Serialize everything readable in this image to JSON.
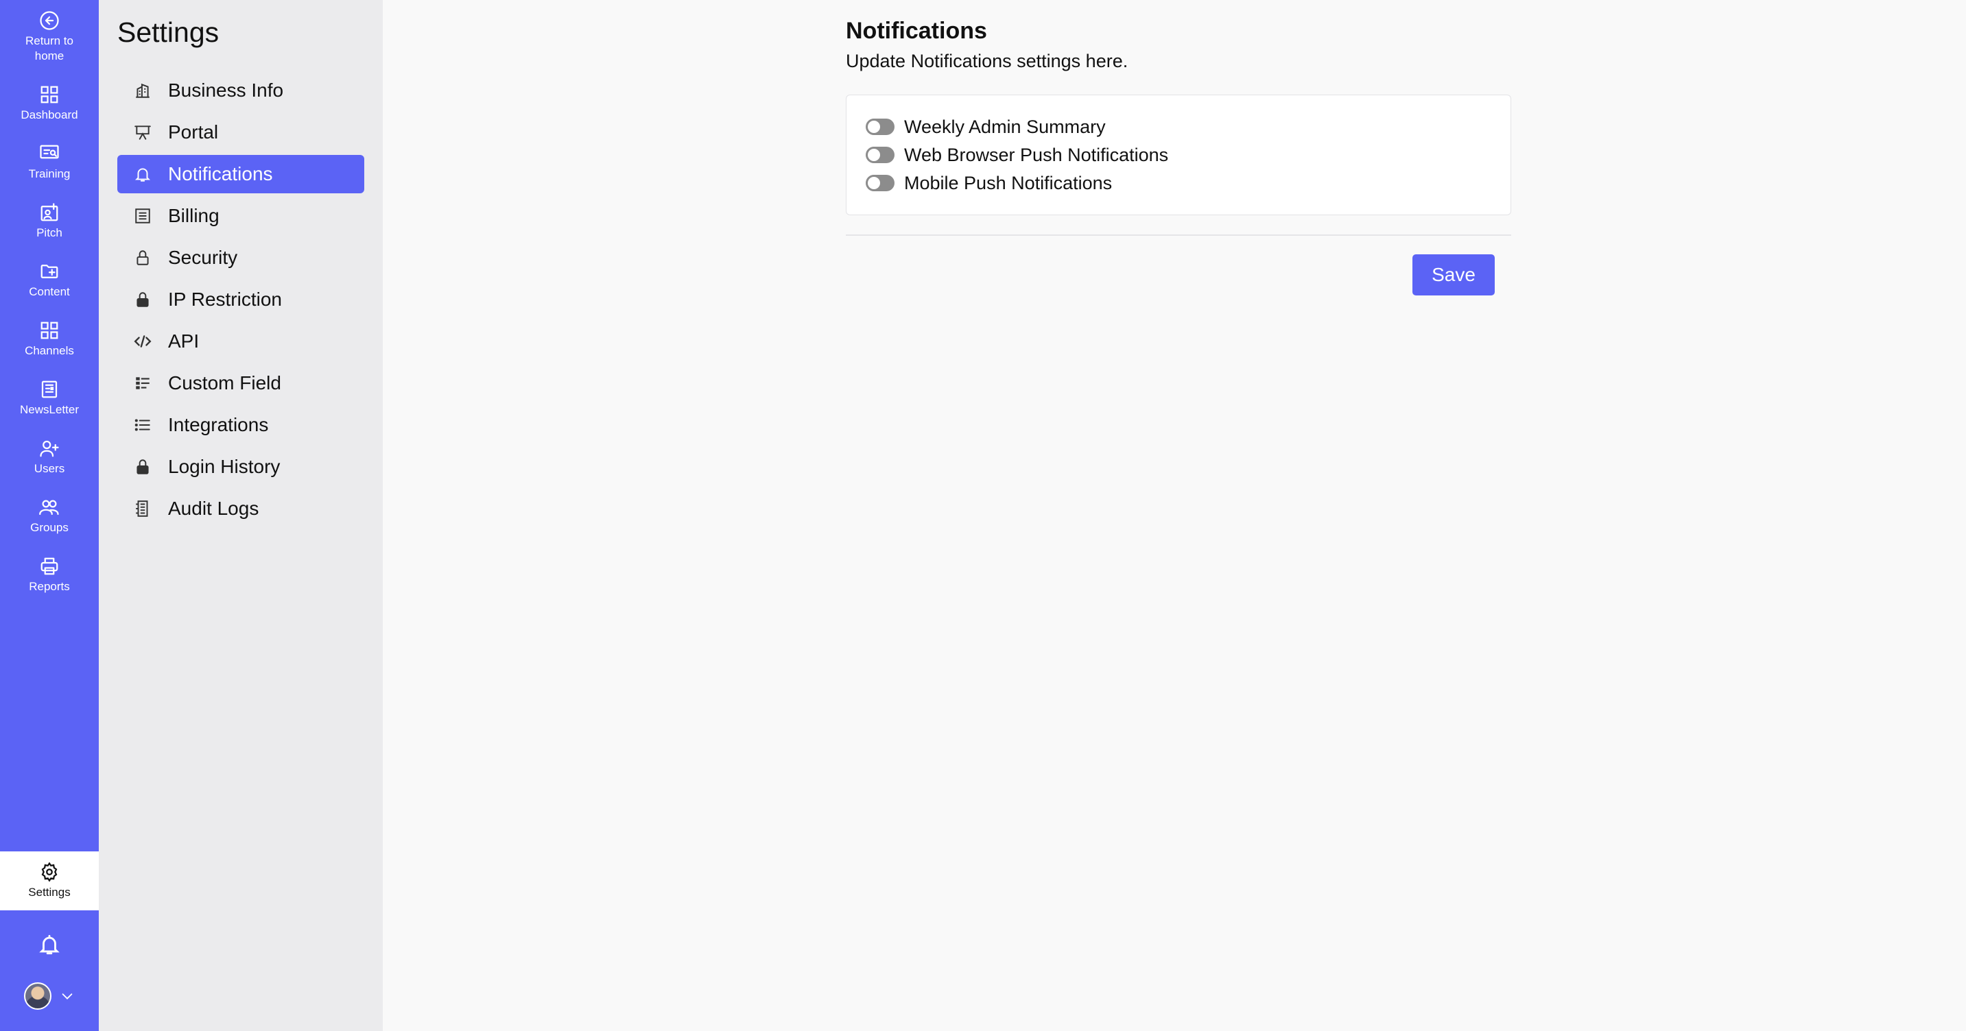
{
  "rail": {
    "items": [
      {
        "label": "Return to home",
        "icon": "arrow-left-circle-icon"
      },
      {
        "label": "Dashboard",
        "icon": "grid-icon"
      },
      {
        "label": "Training",
        "icon": "training-board-icon"
      },
      {
        "label": "Pitch",
        "icon": "pitch-icon"
      },
      {
        "label": "Content",
        "icon": "folder-plus-icon"
      },
      {
        "label": "Channels",
        "icon": "grid-icon"
      },
      {
        "label": "NewsLetter",
        "icon": "newspaper-icon"
      },
      {
        "label": "Users",
        "icon": "user-plus-icon"
      },
      {
        "label": "Groups",
        "icon": "users-icon"
      },
      {
        "label": "Reports",
        "icon": "printer-icon"
      }
    ],
    "settings_label": "Settings",
    "accent": "#5b63f5"
  },
  "sidebar": {
    "title": "Settings",
    "items": [
      {
        "label": "Business Info",
        "icon": "building-icon"
      },
      {
        "label": "Portal",
        "icon": "presentation-icon"
      },
      {
        "label": "Notifications",
        "icon": "bell-icon",
        "active": true
      },
      {
        "label": "Billing",
        "icon": "invoice-icon"
      },
      {
        "label": "Security",
        "icon": "lock-outline-icon"
      },
      {
        "label": "IP Restriction",
        "icon": "lock-icon"
      },
      {
        "label": "API",
        "icon": "code-icon"
      },
      {
        "label": "Custom Field",
        "icon": "fields-icon"
      },
      {
        "label": "Integrations",
        "icon": "list-icon"
      },
      {
        "label": "Login History",
        "icon": "lock-icon"
      },
      {
        "label": "Audit Logs",
        "icon": "audit-icon"
      }
    ]
  },
  "main": {
    "title": "Notifications",
    "subtitle": "Update Notifications settings here.",
    "toggles": [
      {
        "label": "Weekly Admin Summary",
        "on": false
      },
      {
        "label": "Web Browser Push Notifications",
        "on": false
      },
      {
        "label": "Mobile Push Notifications",
        "on": false
      }
    ],
    "save_label": "Save"
  }
}
